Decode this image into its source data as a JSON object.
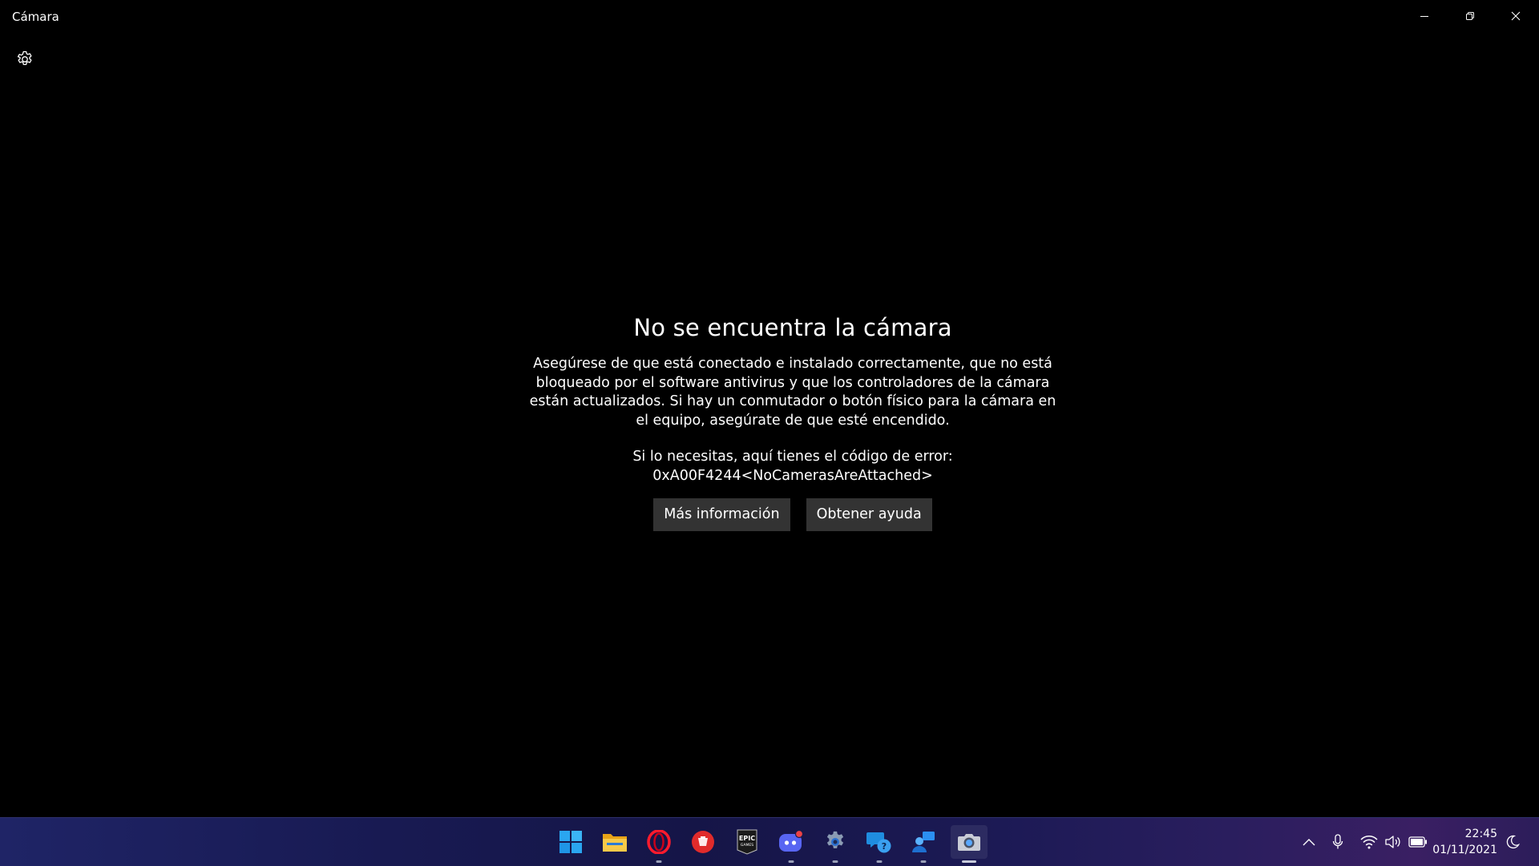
{
  "window": {
    "title": "Cámara",
    "controls": [
      "minimize-icon",
      "restore-icon",
      "close-icon"
    ]
  },
  "toolbar": {
    "settings_icon": "gear-icon"
  },
  "error": {
    "heading": "No se encuentra la cámara",
    "message": "Asegúrese de que está conectado e instalado correctamente, que no está bloqueado por el software antivirus y que los controladores de la cámara están actualizados. Si hay un conmutador o botón físico para la cámara en el equipo, asegúrate de que esté encendido.",
    "code_intro": "Si lo necesitas, aquí tienes el código de error:",
    "code": "0xA00F4244<NoCamerasAreAttached>",
    "buttons": {
      "more_info": "Más información",
      "get_help": "Obtener ayuda"
    }
  },
  "taskbar": {
    "apps": [
      {
        "icon": "windows-start-icon",
        "running": false
      },
      {
        "icon": "file-explorer-icon",
        "running": false
      },
      {
        "icon": "opera-icon",
        "running": true
      },
      {
        "icon": "red-app-icon",
        "running": false
      },
      {
        "icon": "epic-games-icon",
        "label": "EPIC GAMES",
        "running": false
      },
      {
        "icon": "discord-icon",
        "running": true,
        "badge": true
      },
      {
        "icon": "settings-gear-icon",
        "running": true
      },
      {
        "icon": "get-help-icon",
        "running": true
      },
      {
        "icon": "remote-people-icon",
        "running": true
      },
      {
        "icon": "camera-app-icon",
        "running": true,
        "active": true
      }
    ],
    "tray": [
      "chevron-up-icon",
      "microphone-icon",
      "wifi-icon",
      "volume-icon",
      "battery-icon"
    ],
    "time": "22:45",
    "date": "01/11/2021",
    "focus_icon": "moon-icon"
  },
  "colors": {
    "background": "#000000",
    "button": "#333333",
    "accent": "#0078d4"
  }
}
